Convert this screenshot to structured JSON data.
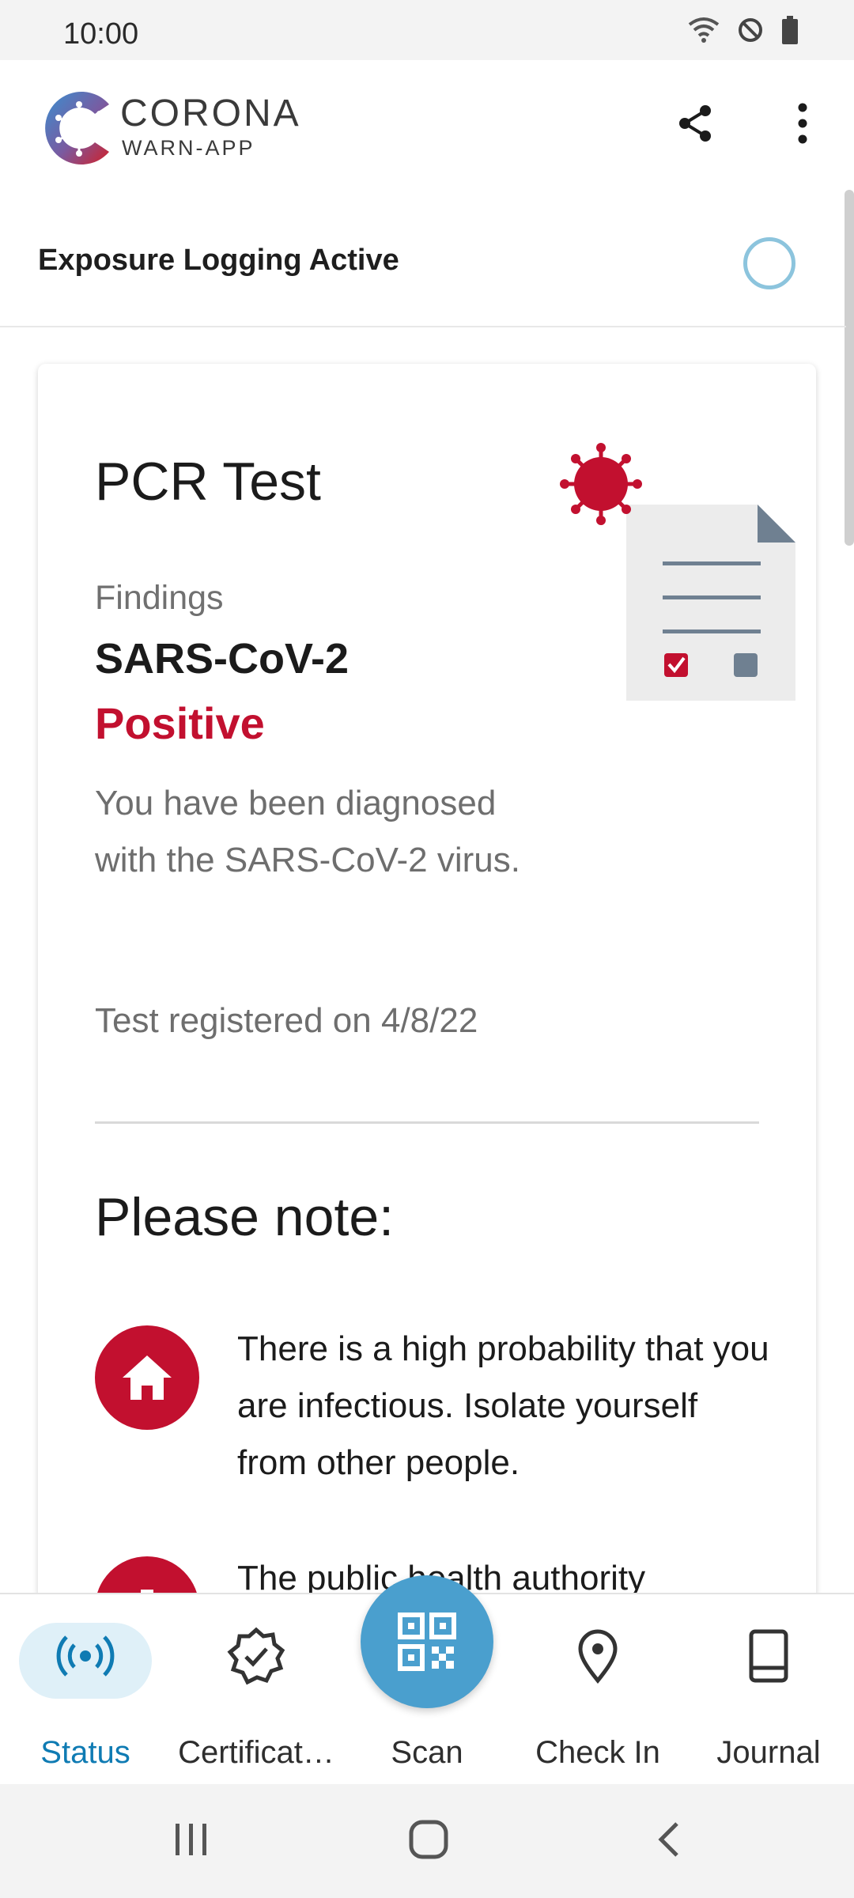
{
  "status_bar": {
    "time": "10:00"
  },
  "app_bar": {
    "brand_line1": "CORONA",
    "brand_line2": "WARN-APP"
  },
  "exposure": {
    "label": "Exposure Logging Active"
  },
  "test_card": {
    "title": "PCR Test",
    "findings_label": "Findings",
    "findings_value": "SARS-CoV-2",
    "result": "Positive",
    "description": "You have been diagnosed with the SARS-CoV-2 virus.",
    "registered": "Test registered on 4/8/22",
    "note_title": "Please note:",
    "tips": [
      {
        "icon": "home-icon",
        "text": "There is a high probability that you are infectious. Isolate yourself from other people."
      },
      {
        "icon": "health-authority-icon",
        "text": "The public health authority"
      }
    ]
  },
  "bottom_nav": {
    "items": [
      {
        "label": "Status",
        "icon": "status-icon",
        "active": true
      },
      {
        "label": "Certificat…",
        "icon": "certificate-icon"
      },
      {
        "label": "Scan",
        "icon": "qr-scan-icon"
      },
      {
        "label": "Check In",
        "icon": "location-pin-icon"
      },
      {
        "label": "Journal",
        "icon": "journal-icon"
      }
    ]
  },
  "colors": {
    "accent": "#0f7bb3",
    "positive_red": "#c2102f",
    "scan_fab": "#4a9fce"
  }
}
